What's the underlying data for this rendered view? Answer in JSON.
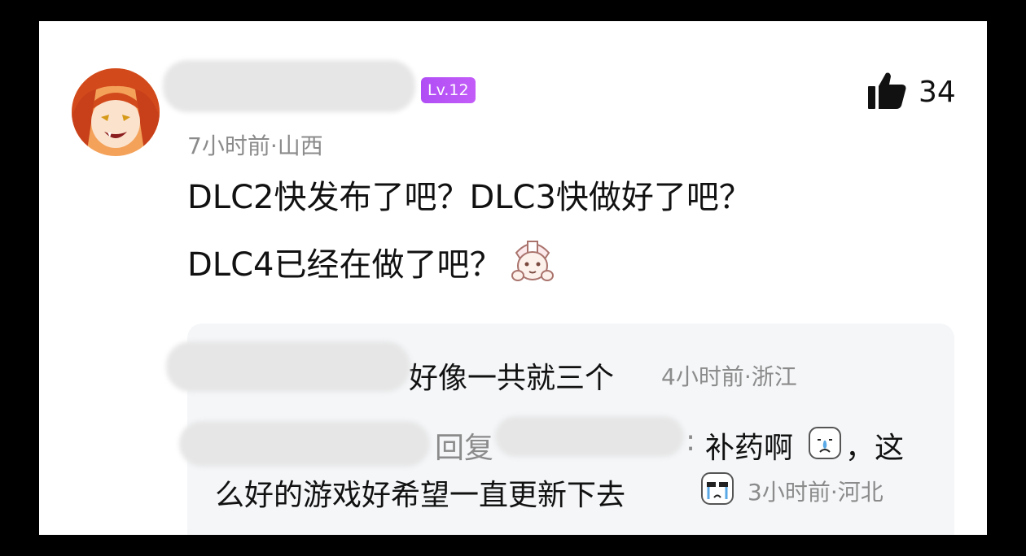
{
  "comment": {
    "level_badge": "Lv.12",
    "meta": "7小时前·山西",
    "likes": "34",
    "content_line1": "DLC2快发布了吧？DLC3快做好了吧？",
    "content_line2": "DLC4已经在做了吧？",
    "emoji_icon": "face-with-hands-emoji-icon"
  },
  "replies": [
    {
      "text": "好像一共就三个",
      "meta": "4小时前·浙江"
    },
    {
      "reply_word": "回复",
      "colon": ":",
      "text_part1": "补药啊",
      "text_part2": "，这",
      "text_line2": "么好的游戏好希望一直更新下去",
      "meta": "3小时前·河北",
      "emoji_icons": [
        "crying-face-emoji-icon",
        "crying-face-emoji-icon"
      ]
    }
  ],
  "colors": {
    "badge": "#b04ef5",
    "meta_text": "#8b8b8b",
    "reply_bg": "#f4f6f8"
  }
}
